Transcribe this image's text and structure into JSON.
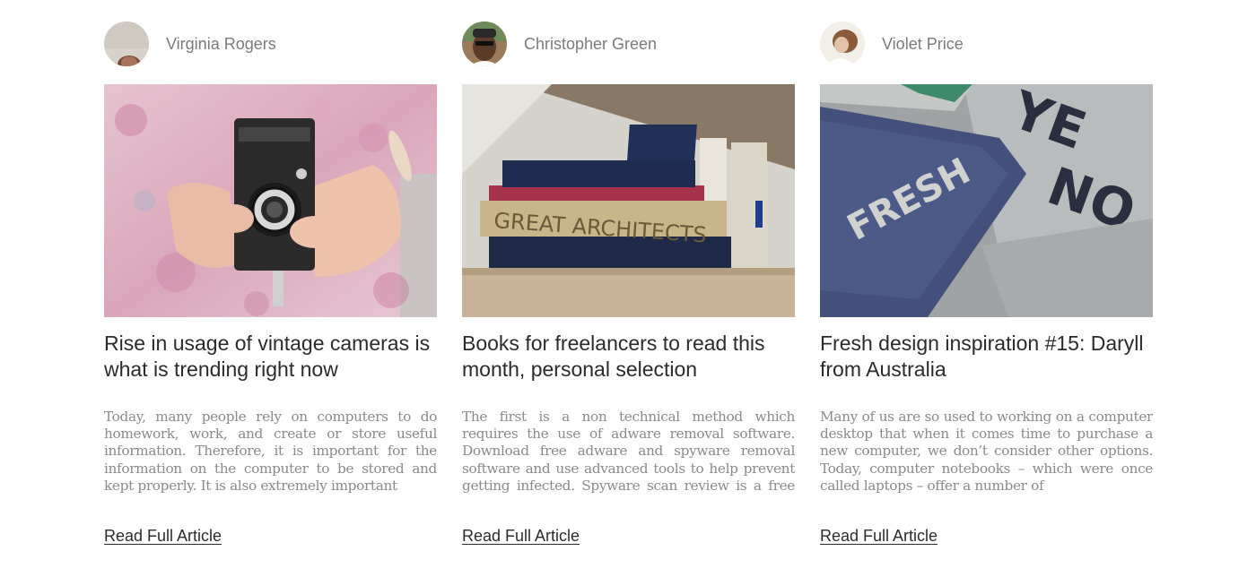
{
  "articles": [
    {
      "author": "Virginia Rogers",
      "image": "vintage-camera-photo",
      "title": "Rise in usage of vintage cameras is what is trending right now",
      "excerpt": "Today, many people rely on computers to do homework, work, and create or store useful information. Therefore, it is important for the information on the computer to be stored and kept properly. It is also extremely important",
      "link_label": "Read Full Article"
    },
    {
      "author": "Christopher Green",
      "image": "bookshelf-photo",
      "image_text": "GREAT ARCHITECTS",
      "title": "Books for freelancers to read this month, personal selection",
      "excerpt": "The first is a non technical method which requires the use of adware removal software. Download free adware and spyware removal software and use advanced tools to help prevent getting infected. Spyware scan review is a free service",
      "link_label": "Read Full Article"
    },
    {
      "author": "Violet Price",
      "image": "fresh-pillow-photo",
      "image_text": "FRESH",
      "title": "Fresh design inspiration #15: Daryll from Australia",
      "excerpt": "Many of us are so used to working on a computer desktop that when it comes time to purchase a new computer, we don’t consider other options. Today, computer notebooks – which were once called laptops – offer a number of",
      "link_label": "Read Full Article"
    }
  ]
}
